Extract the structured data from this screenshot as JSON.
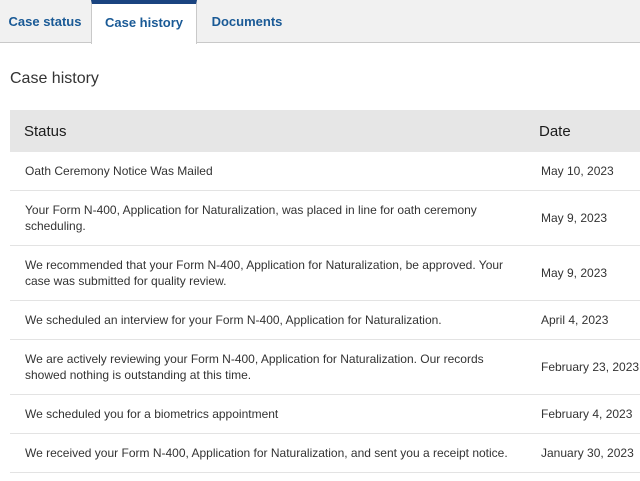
{
  "tabs": [
    {
      "label": "Case status"
    },
    {
      "label": "Case history"
    },
    {
      "label": "Documents"
    }
  ],
  "section_title": "Case history",
  "table": {
    "headers": {
      "status": "Status",
      "date": "Date"
    },
    "rows": [
      {
        "status": "Oath Ceremony Notice Was Mailed",
        "date": "May 10, 2023"
      },
      {
        "status": "Your Form N-400, Application for Naturalization, was placed in line for oath ceremony scheduling.",
        "date": "May 9, 2023"
      },
      {
        "status": "We recommended that your Form N-400, Application for Naturalization, be approved. Your case was submitted for quality review.",
        "date": "May 9, 2023"
      },
      {
        "status": "We scheduled an interview for your Form N-400, Application for Naturalization.",
        "date": "April 4, 2023"
      },
      {
        "status": "We are actively reviewing your Form N-400, Application for Naturalization. Our records showed nothing is outstanding at this time.",
        "date": "February 23, 2023"
      },
      {
        "status": "We scheduled you for a biometrics appointment",
        "date": "February 4, 2023"
      },
      {
        "status": "We received your Form N-400, Application for Naturalization, and sent you a receipt notice.",
        "date": "January 30, 2023"
      }
    ]
  },
  "colors": {
    "tab_text": "#1a5a96",
    "active_tab_border": "#1a4480",
    "header_bg": "#e6e6e6"
  }
}
